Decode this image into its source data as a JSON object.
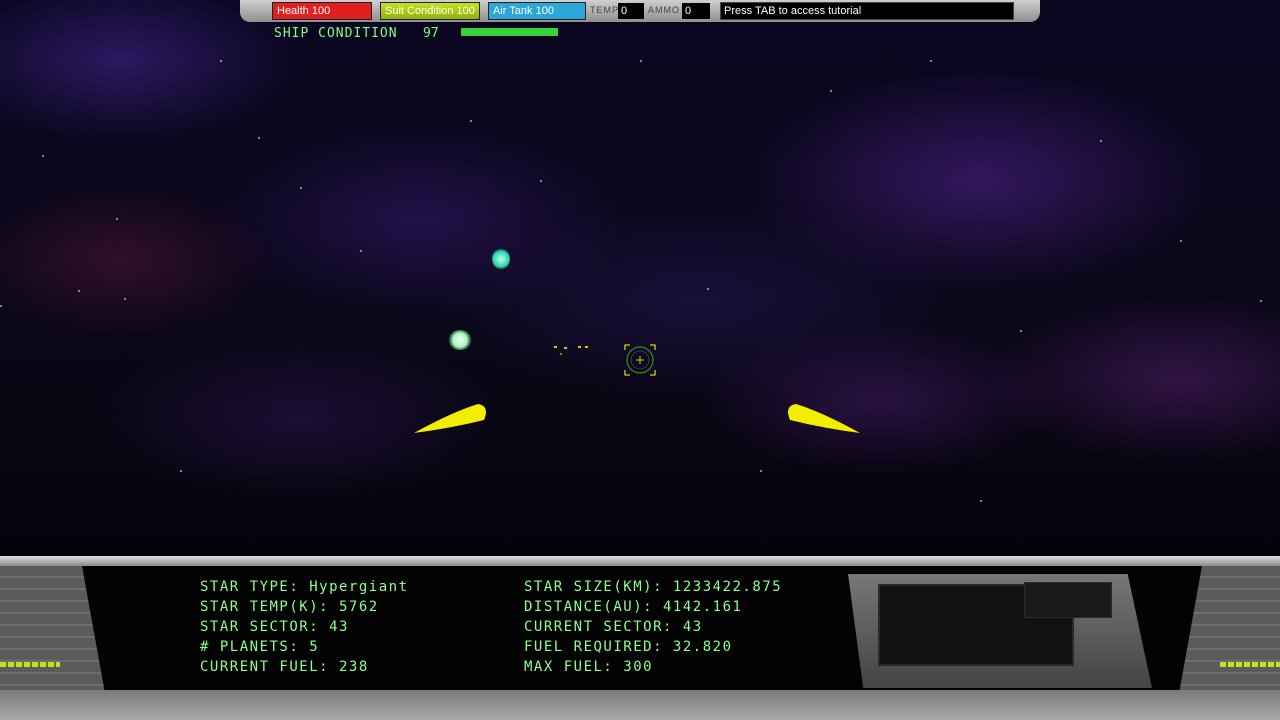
{
  "hud": {
    "health": "Health 100",
    "suit": "Suit Condition 100",
    "air": "Air Tank 100",
    "temp_label": "TEMP",
    "temp_value": "0",
    "ammo_label": "AMMO",
    "ammo_value": "0",
    "tutorial": "Press TAB to access tutorial"
  },
  "ship": {
    "label": "SHIP CONDITION",
    "value": "97",
    "level_percent": 97,
    "bar_color": "#36d23a"
  },
  "readout": {
    "left": [
      "STAR TYPE: Hypergiant",
      "STAR TEMP(K): 5762",
      "STAR SECTOR: 43",
      "# PLANETS: 5",
      "CURRENT FUEL: 238"
    ],
    "right": [
      "STAR SIZE(KM): 1233422.875",
      "DISTANCE(AU): 4142.161",
      "CURRENT SECTOR: 43",
      "FUEL REQUIRED: 32.820",
      "MAX FUEL: 300"
    ]
  },
  "colors": {
    "readout_text": "#8dff8d",
    "health": "#e02020",
    "air": "#2aa7d8",
    "yellow_marker": "#f2ee00"
  },
  "icons": {
    "crosshair": "targeting-reticle-icon"
  }
}
